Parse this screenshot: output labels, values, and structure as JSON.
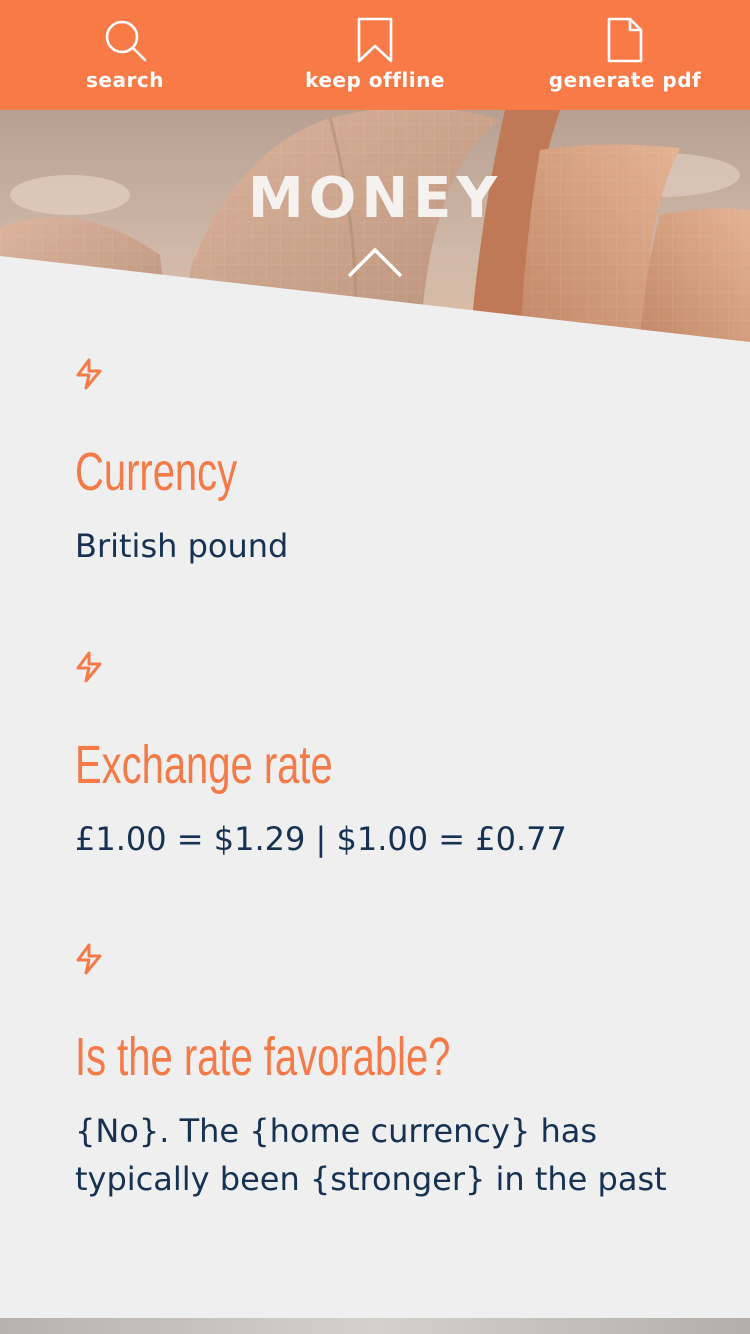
{
  "toolbar": {
    "items": [
      {
        "label": "search",
        "icon": "search-icon"
      },
      {
        "label": "keep offline",
        "icon": "bookmark-icon"
      },
      {
        "label": "generate pdf",
        "icon": "document-icon"
      }
    ]
  },
  "hero": {
    "title": "MONEY",
    "collapse_icon": "chevron-up-icon"
  },
  "sections": [
    {
      "icon": "lightning-icon",
      "heading": "Currency",
      "value": "British pound"
    },
    {
      "icon": "lightning-icon",
      "heading": "Exchange rate",
      "value": "£1.00 = $1.29 | $1.00 = £0.77"
    },
    {
      "icon": "lightning-icon",
      "heading": "Is the rate favorable?",
      "value": "{No}. The {home currency} has typically been {stronger} in the past"
    }
  ],
  "colors": {
    "accent": "#f77a47",
    "heading": "#f47a48",
    "body_text": "#163152",
    "background": "#f0efef"
  }
}
